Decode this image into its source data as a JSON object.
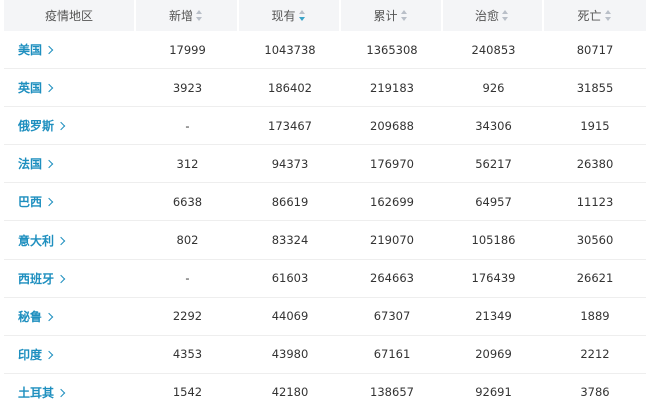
{
  "table": {
    "headers": [
      {
        "label": "疫情地区",
        "sortable": false,
        "active": false
      },
      {
        "label": "新增",
        "sortable": true,
        "active": false
      },
      {
        "label": "现有",
        "sortable": true,
        "active": true
      },
      {
        "label": "累计",
        "sortable": true,
        "active": false
      },
      {
        "label": "治愈",
        "sortable": true,
        "active": false
      },
      {
        "label": "死亡",
        "sortable": true,
        "active": false
      }
    ],
    "rows": [
      {
        "region": "美国",
        "new": "17999",
        "current": "1043738",
        "total": "1365308",
        "cured": "240853",
        "deaths": "80717"
      },
      {
        "region": "英国",
        "new": "3923",
        "current": "186402",
        "total": "219183",
        "cured": "926",
        "deaths": "31855"
      },
      {
        "region": "俄罗斯",
        "new": "-",
        "current": "173467",
        "total": "209688",
        "cured": "34306",
        "deaths": "1915"
      },
      {
        "region": "法国",
        "new": "312",
        "current": "94373",
        "total": "176970",
        "cured": "56217",
        "deaths": "26380"
      },
      {
        "region": "巴西",
        "new": "6638",
        "current": "86619",
        "total": "162699",
        "cured": "64957",
        "deaths": "11123"
      },
      {
        "region": "意大利",
        "new": "802",
        "current": "83324",
        "total": "219070",
        "cured": "105186",
        "deaths": "30560"
      },
      {
        "region": "西班牙",
        "new": "-",
        "current": "61603",
        "total": "264663",
        "cured": "176439",
        "deaths": "26621"
      },
      {
        "region": "秘鲁",
        "new": "2292",
        "current": "44069",
        "total": "67307",
        "cured": "21349",
        "deaths": "1889"
      },
      {
        "region": "印度",
        "new": "4353",
        "current": "43980",
        "total": "67161",
        "cured": "20969",
        "deaths": "2212"
      },
      {
        "region": "土耳其",
        "new": "1542",
        "current": "42180",
        "total": "138657",
        "cured": "92691",
        "deaths": "3786"
      }
    ]
  },
  "colors": {
    "header_bg": "#f4f5f7",
    "region_link": "#1e8fbf",
    "sort_active": "#3aa3c8",
    "sort_inactive": "#b9bfc8",
    "row_divider": "#eeeeee"
  }
}
